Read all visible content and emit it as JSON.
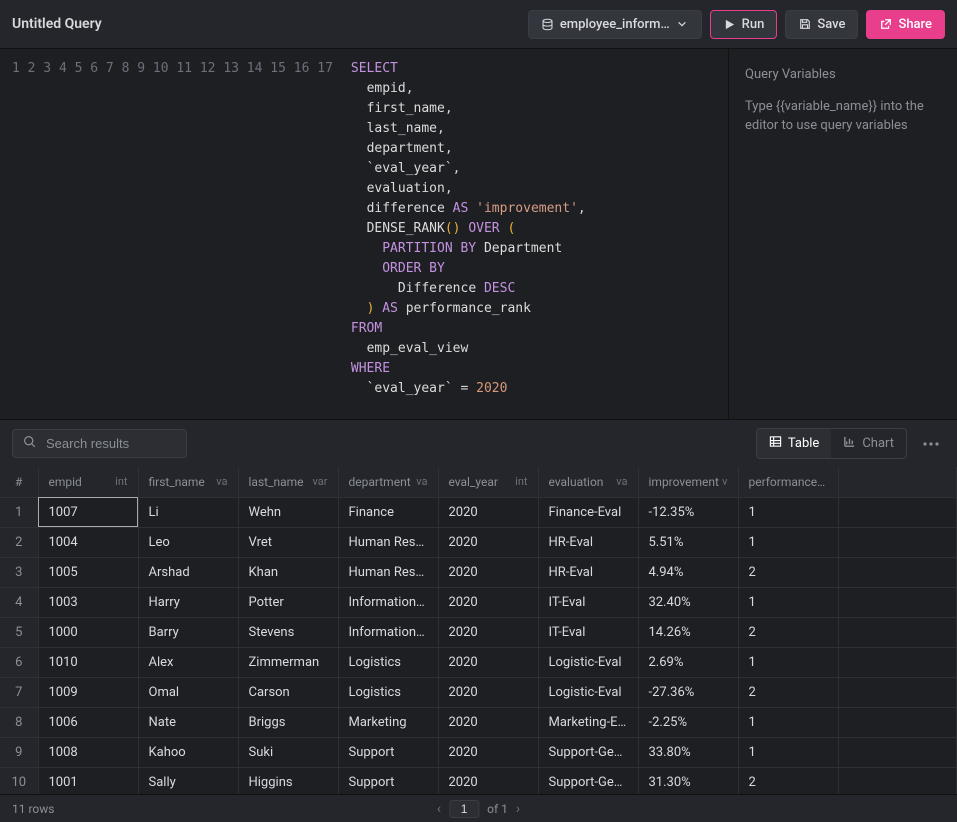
{
  "header": {
    "title": "Untitled Query",
    "db_label": "employee_inform…",
    "run_label": "Run",
    "save_label": "Save",
    "share_label": "Share"
  },
  "editor": {
    "lines": 17
  },
  "vars_panel": {
    "title": "Query Variables",
    "hint": "Type {{variable_name}} into the editor to use query variables"
  },
  "results_bar": {
    "search_placeholder": "Search results",
    "table_label": "Table",
    "chart_label": "Chart"
  },
  "columns": [
    {
      "name": "empid",
      "type": "int"
    },
    {
      "name": "first_name",
      "type": "va"
    },
    {
      "name": "last_name",
      "type": "var"
    },
    {
      "name": "department",
      "type": "va"
    },
    {
      "name": "eval_year",
      "type": "int"
    },
    {
      "name": "evaluation",
      "type": "va"
    },
    {
      "name": "improvement",
      "type": "v"
    },
    {
      "name": "performance_ran",
      "type": ""
    }
  ],
  "rows": [
    {
      "n": 1,
      "empid": "1007",
      "first_name": "Li",
      "last_name": "Wehn",
      "department": "Finance",
      "eval_year": "2020",
      "evaluation": "Finance-Eval",
      "improvement": "-12.35%",
      "rank": "1"
    },
    {
      "n": 2,
      "empid": "1004",
      "first_name": "Leo",
      "last_name": "Vret",
      "department": "Human Reso…",
      "eval_year": "2020",
      "evaluation": "HR-Eval",
      "improvement": "5.51%",
      "rank": "1"
    },
    {
      "n": 3,
      "empid": "1005",
      "first_name": "Arshad",
      "last_name": "Khan",
      "department": "Human Reso…",
      "eval_year": "2020",
      "evaluation": "HR-Eval",
      "improvement": "4.94%",
      "rank": "2"
    },
    {
      "n": 4,
      "empid": "1003",
      "first_name": "Harry",
      "last_name": "Potter",
      "department": "Information …",
      "eval_year": "2020",
      "evaluation": "IT-Eval",
      "improvement": "32.40%",
      "rank": "1"
    },
    {
      "n": 5,
      "empid": "1000",
      "first_name": "Barry",
      "last_name": "Stevens",
      "department": "Information …",
      "eval_year": "2020",
      "evaluation": "IT-Eval",
      "improvement": "14.26%",
      "rank": "2"
    },
    {
      "n": 6,
      "empid": "1010",
      "first_name": "Alex",
      "last_name": "Zimmerman",
      "department": "Logistics",
      "eval_year": "2020",
      "evaluation": "Logistic-Eval",
      "improvement": "2.69%",
      "rank": "1"
    },
    {
      "n": 7,
      "empid": "1009",
      "first_name": "Omal",
      "last_name": "Carson",
      "department": "Logistics",
      "eval_year": "2020",
      "evaluation": "Logistic-Eval",
      "improvement": "-27.36%",
      "rank": "2"
    },
    {
      "n": 8,
      "empid": "1006",
      "first_name": "Nate",
      "last_name": "Briggs",
      "department": "Marketing",
      "eval_year": "2020",
      "evaluation": "Marketing-E…",
      "improvement": "-2.25%",
      "rank": "1"
    },
    {
      "n": 9,
      "empid": "1008",
      "first_name": "Kahoo",
      "last_name": "Suki",
      "department": "Support",
      "eval_year": "2020",
      "evaluation": "Support-Gen…",
      "improvement": "33.80%",
      "rank": "1"
    },
    {
      "n": 10,
      "empid": "1001",
      "first_name": "Sally",
      "last_name": "Higgins",
      "department": "Support",
      "eval_year": "2020",
      "evaluation": "Support-Gen…",
      "improvement": "31.30%",
      "rank": "2"
    }
  ],
  "footer": {
    "row_count": "11 rows",
    "page": "1",
    "total_pages": "of 1"
  }
}
